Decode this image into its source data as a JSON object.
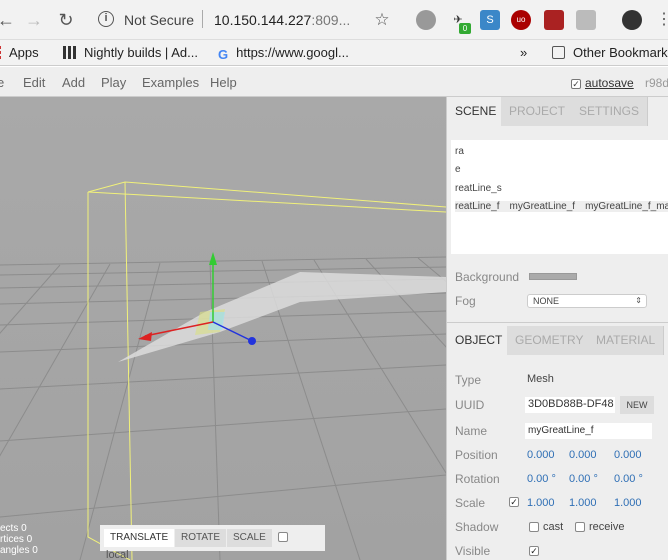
{
  "browser": {
    "security": "Not Secure",
    "url_host": "10.150.144.227",
    "url_rest": ":809...",
    "ext_badge": "0"
  },
  "bookmarks": {
    "apps": "Apps",
    "nightly": "Nightly builds | Ad...",
    "google": "https://www.googl...",
    "overflow": "»",
    "other": "Other Bookmarks"
  },
  "menubar": {
    "items": [
      "e",
      "Edit",
      "Add",
      "Play",
      "Examples",
      "Help"
    ],
    "autosave_label": "autosave",
    "revision": "r98d"
  },
  "viewport": {
    "info": [
      "ects  0",
      "rtices  0",
      "angles  0"
    ],
    "toolbar": [
      "TRANSLATE",
      "ROTATE",
      "SCALE"
    ],
    "space_label": "local"
  },
  "sidebar": {
    "tabs": [
      "SCENE",
      "PROJECT",
      "SETTINGS"
    ],
    "outliner": [
      "ra",
      "e",
      "reatLine_s",
      "reatLine_f"
    ],
    "outliner_extra": [
      "myGreatLine_f",
      "myGreatLine_f_mat"
    ],
    "background_label": "Background",
    "background_color": "#aaaaaa",
    "fog_label": "Fog",
    "fog_value": "NONE",
    "object_tabs": [
      "OBJECT",
      "GEOMETRY",
      "MATERIAL"
    ],
    "object": {
      "type_label": "Type",
      "type_value": "Mesh",
      "uuid_label": "UUID",
      "uuid_value": "3D0BD88B-DF48",
      "new_label": "NEW",
      "name_label": "Name",
      "name_value": "myGreatLine_f",
      "position_label": "Position",
      "position": [
        "0.000",
        "0.000",
        "0.000"
      ],
      "rotation_label": "Rotation",
      "rotation": [
        "0.00 °",
        "0.00 °",
        "0.00 °"
      ],
      "scale_label": "Scale",
      "scale": [
        "1.000",
        "1.000",
        "1.000"
      ],
      "shadow_label": "Shadow",
      "cast_label": "cast",
      "receive_label": "receive",
      "visible_label": "Visible"
    }
  }
}
